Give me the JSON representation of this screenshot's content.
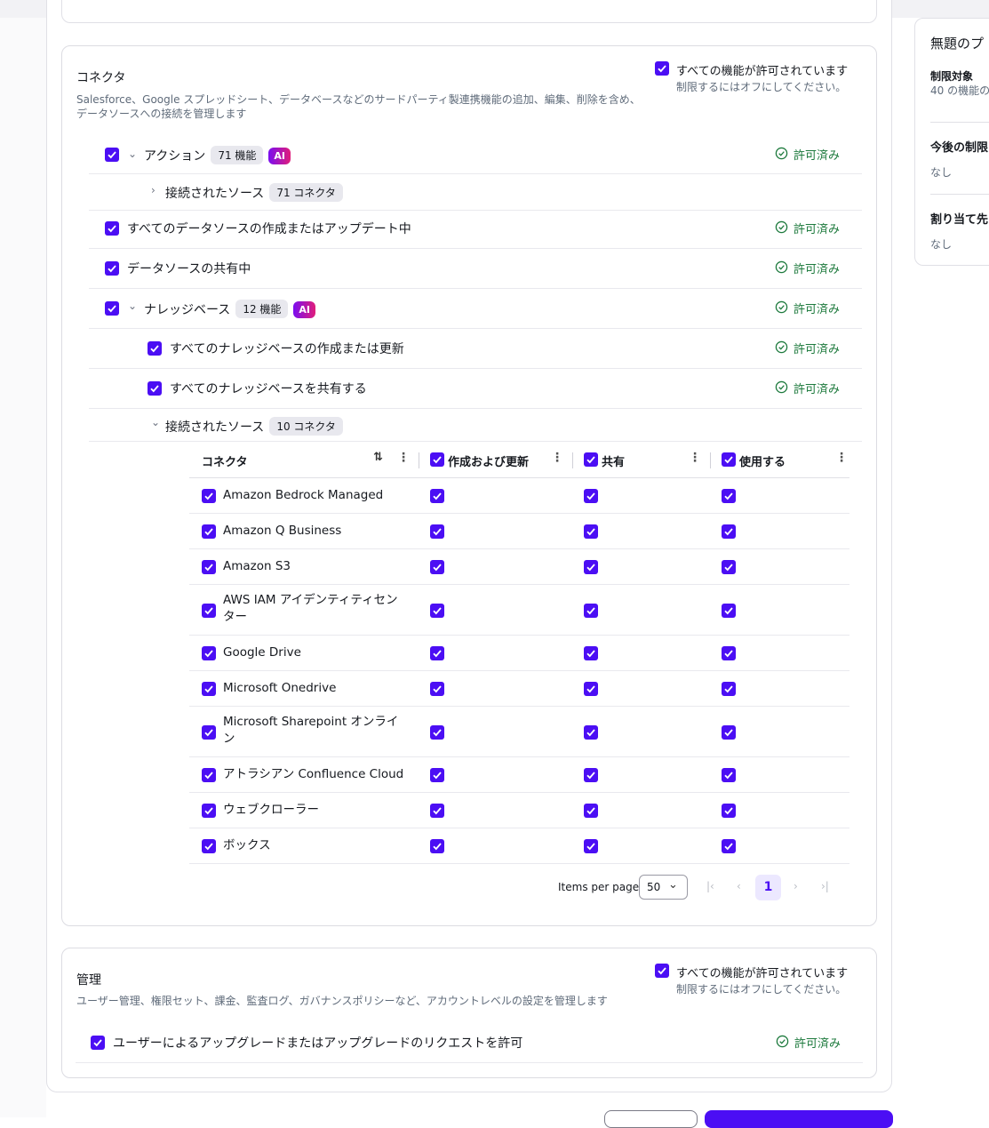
{
  "connectors": {
    "title": "コネクタ",
    "description_line1": "Salesforce、Google スプレッドシート、データベースなどのサードパーティ製連携機能の追加、編集、削除を含め、",
    "description_line2": "データソースへの接続を管理します",
    "allow_all_label": "すべての機能が許可されています",
    "allow_all_sub": "制限するにはオフにしてください。",
    "rows": [
      {
        "label": "アクション",
        "pill": "71 機能",
        "ai": "AI",
        "status": "許可済み"
      },
      {
        "label": "接続されたソース",
        "pill": "71 コネクタ"
      },
      {
        "label": "すべてのデータソースの作成またはアップデート中",
        "status": "許可済み"
      },
      {
        "label": "データソースの共有中",
        "status": "許可済み"
      },
      {
        "label": "ナレッジベース",
        "pill": "12 機能",
        "ai": "AI",
        "status": "許可済み"
      },
      {
        "label": "すべてのナレッジベースの作成または更新",
        "status": "許可済み"
      },
      {
        "label": "すべてのナレッジベースを共有する",
        "status": "許可済み"
      },
      {
        "label": "接続されたソース",
        "pill": "10 コネクタ"
      }
    ],
    "table": {
      "headers": {
        "name": "コネクタ",
        "create": "作成および更新",
        "share": "共有",
        "use": "使用する"
      },
      "items": [
        "Amazon Bedrock Managed",
        "Amazon Q Business",
        "Amazon S3",
        "AWS IAM アイデンティティセン\nター",
        "Google Drive",
        "Microsoft Onedrive",
        "Microsoft Sharepoint オンライ\nン",
        "アトラシアン Confluence Cloud",
        "ウェブクローラー",
        "ボックス"
      ]
    },
    "pagination": {
      "items_per_page_label": "Items per page",
      "page_size": "50",
      "current_page": "1"
    }
  },
  "management": {
    "title": "管理",
    "description": "ユーザー管理、権限セット、課金、監査ログ、ガバナンスポリシーなど、アカウントレベルの設定を管理します",
    "allow_all_label": "すべての機能が許可されています",
    "allow_all_sub": "制限するにはオフにしてください。",
    "rows": [
      {
        "label": "ユーザーによるアップグレードまたはアップグレードのリクエストを許可",
        "status": "許可済み"
      }
    ]
  },
  "side_panel": {
    "title": "無題のプ",
    "restricted_label": "制限対象",
    "restricted_value": "40 の機能の",
    "future_label": "今後の制限",
    "future_value": "なし",
    "assigned_label": "割り当て先",
    "assigned_value": "なし"
  },
  "colors": {
    "accent": "#4b0ef4",
    "allowed": "#1d7a3d"
  }
}
